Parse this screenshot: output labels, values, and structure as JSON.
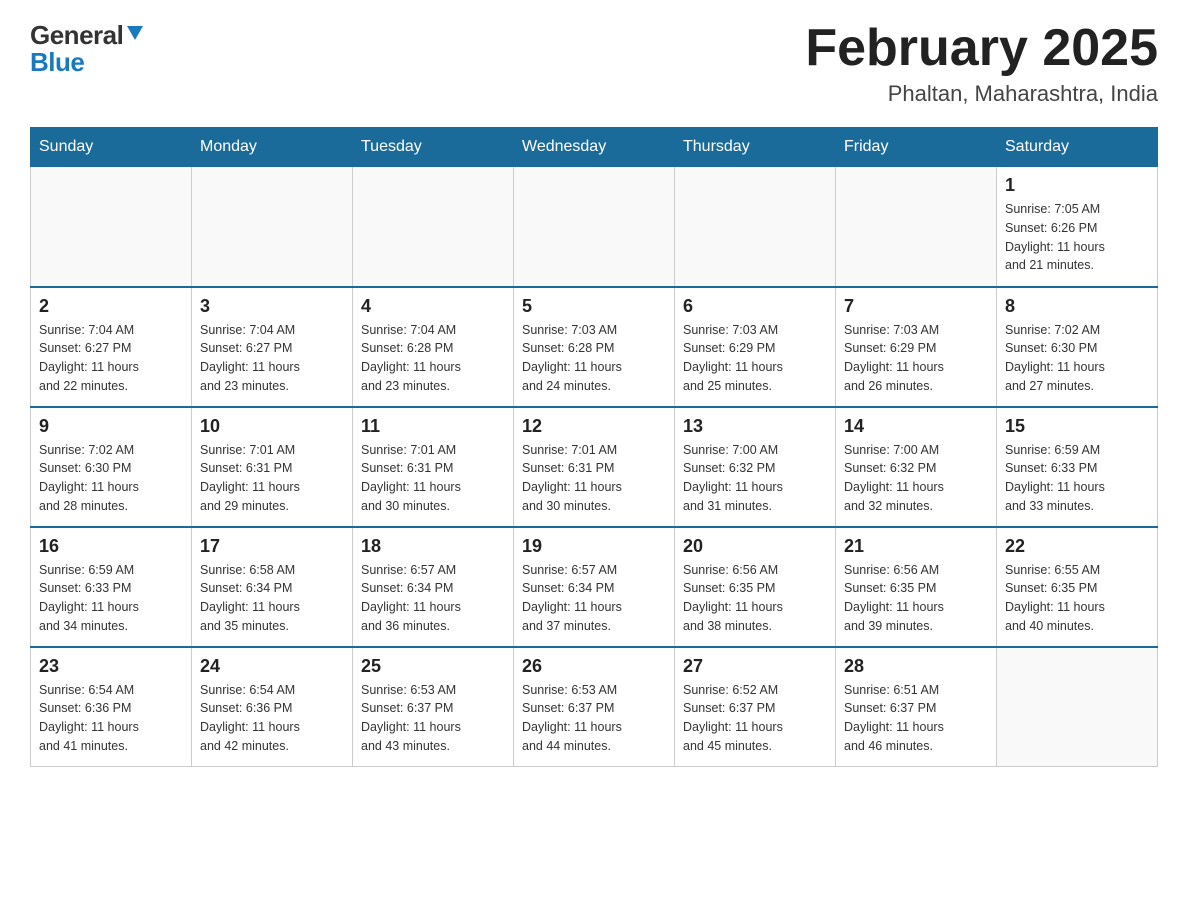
{
  "logo": {
    "general": "General",
    "blue": "Blue",
    "triangle": "▲"
  },
  "header": {
    "month": "February 2025",
    "location": "Phaltan, Maharashtra, India"
  },
  "weekdays": [
    "Sunday",
    "Monday",
    "Tuesday",
    "Wednesday",
    "Thursday",
    "Friday",
    "Saturday"
  ],
  "weeks": [
    [
      {
        "day": "",
        "info": ""
      },
      {
        "day": "",
        "info": ""
      },
      {
        "day": "",
        "info": ""
      },
      {
        "day": "",
        "info": ""
      },
      {
        "day": "",
        "info": ""
      },
      {
        "day": "",
        "info": ""
      },
      {
        "day": "1",
        "info": "Sunrise: 7:05 AM\nSunset: 6:26 PM\nDaylight: 11 hours\nand 21 minutes."
      }
    ],
    [
      {
        "day": "2",
        "info": "Sunrise: 7:04 AM\nSunset: 6:27 PM\nDaylight: 11 hours\nand 22 minutes."
      },
      {
        "day": "3",
        "info": "Sunrise: 7:04 AM\nSunset: 6:27 PM\nDaylight: 11 hours\nand 23 minutes."
      },
      {
        "day": "4",
        "info": "Sunrise: 7:04 AM\nSunset: 6:28 PM\nDaylight: 11 hours\nand 23 minutes."
      },
      {
        "day": "5",
        "info": "Sunrise: 7:03 AM\nSunset: 6:28 PM\nDaylight: 11 hours\nand 24 minutes."
      },
      {
        "day": "6",
        "info": "Sunrise: 7:03 AM\nSunset: 6:29 PM\nDaylight: 11 hours\nand 25 minutes."
      },
      {
        "day": "7",
        "info": "Sunrise: 7:03 AM\nSunset: 6:29 PM\nDaylight: 11 hours\nand 26 minutes."
      },
      {
        "day": "8",
        "info": "Sunrise: 7:02 AM\nSunset: 6:30 PM\nDaylight: 11 hours\nand 27 minutes."
      }
    ],
    [
      {
        "day": "9",
        "info": "Sunrise: 7:02 AM\nSunset: 6:30 PM\nDaylight: 11 hours\nand 28 minutes."
      },
      {
        "day": "10",
        "info": "Sunrise: 7:01 AM\nSunset: 6:31 PM\nDaylight: 11 hours\nand 29 minutes."
      },
      {
        "day": "11",
        "info": "Sunrise: 7:01 AM\nSunset: 6:31 PM\nDaylight: 11 hours\nand 30 minutes."
      },
      {
        "day": "12",
        "info": "Sunrise: 7:01 AM\nSunset: 6:31 PM\nDaylight: 11 hours\nand 30 minutes."
      },
      {
        "day": "13",
        "info": "Sunrise: 7:00 AM\nSunset: 6:32 PM\nDaylight: 11 hours\nand 31 minutes."
      },
      {
        "day": "14",
        "info": "Sunrise: 7:00 AM\nSunset: 6:32 PM\nDaylight: 11 hours\nand 32 minutes."
      },
      {
        "day": "15",
        "info": "Sunrise: 6:59 AM\nSunset: 6:33 PM\nDaylight: 11 hours\nand 33 minutes."
      }
    ],
    [
      {
        "day": "16",
        "info": "Sunrise: 6:59 AM\nSunset: 6:33 PM\nDaylight: 11 hours\nand 34 minutes."
      },
      {
        "day": "17",
        "info": "Sunrise: 6:58 AM\nSunset: 6:34 PM\nDaylight: 11 hours\nand 35 minutes."
      },
      {
        "day": "18",
        "info": "Sunrise: 6:57 AM\nSunset: 6:34 PM\nDaylight: 11 hours\nand 36 minutes."
      },
      {
        "day": "19",
        "info": "Sunrise: 6:57 AM\nSunset: 6:34 PM\nDaylight: 11 hours\nand 37 minutes."
      },
      {
        "day": "20",
        "info": "Sunrise: 6:56 AM\nSunset: 6:35 PM\nDaylight: 11 hours\nand 38 minutes."
      },
      {
        "day": "21",
        "info": "Sunrise: 6:56 AM\nSunset: 6:35 PM\nDaylight: 11 hours\nand 39 minutes."
      },
      {
        "day": "22",
        "info": "Sunrise: 6:55 AM\nSunset: 6:35 PM\nDaylight: 11 hours\nand 40 minutes."
      }
    ],
    [
      {
        "day": "23",
        "info": "Sunrise: 6:54 AM\nSunset: 6:36 PM\nDaylight: 11 hours\nand 41 minutes."
      },
      {
        "day": "24",
        "info": "Sunrise: 6:54 AM\nSunset: 6:36 PM\nDaylight: 11 hours\nand 42 minutes."
      },
      {
        "day": "25",
        "info": "Sunrise: 6:53 AM\nSunset: 6:37 PM\nDaylight: 11 hours\nand 43 minutes."
      },
      {
        "day": "26",
        "info": "Sunrise: 6:53 AM\nSunset: 6:37 PM\nDaylight: 11 hours\nand 44 minutes."
      },
      {
        "day": "27",
        "info": "Sunrise: 6:52 AM\nSunset: 6:37 PM\nDaylight: 11 hours\nand 45 minutes."
      },
      {
        "day": "28",
        "info": "Sunrise: 6:51 AM\nSunset: 6:37 PM\nDaylight: 11 hours\nand 46 minutes."
      },
      {
        "day": "",
        "info": ""
      }
    ]
  ]
}
